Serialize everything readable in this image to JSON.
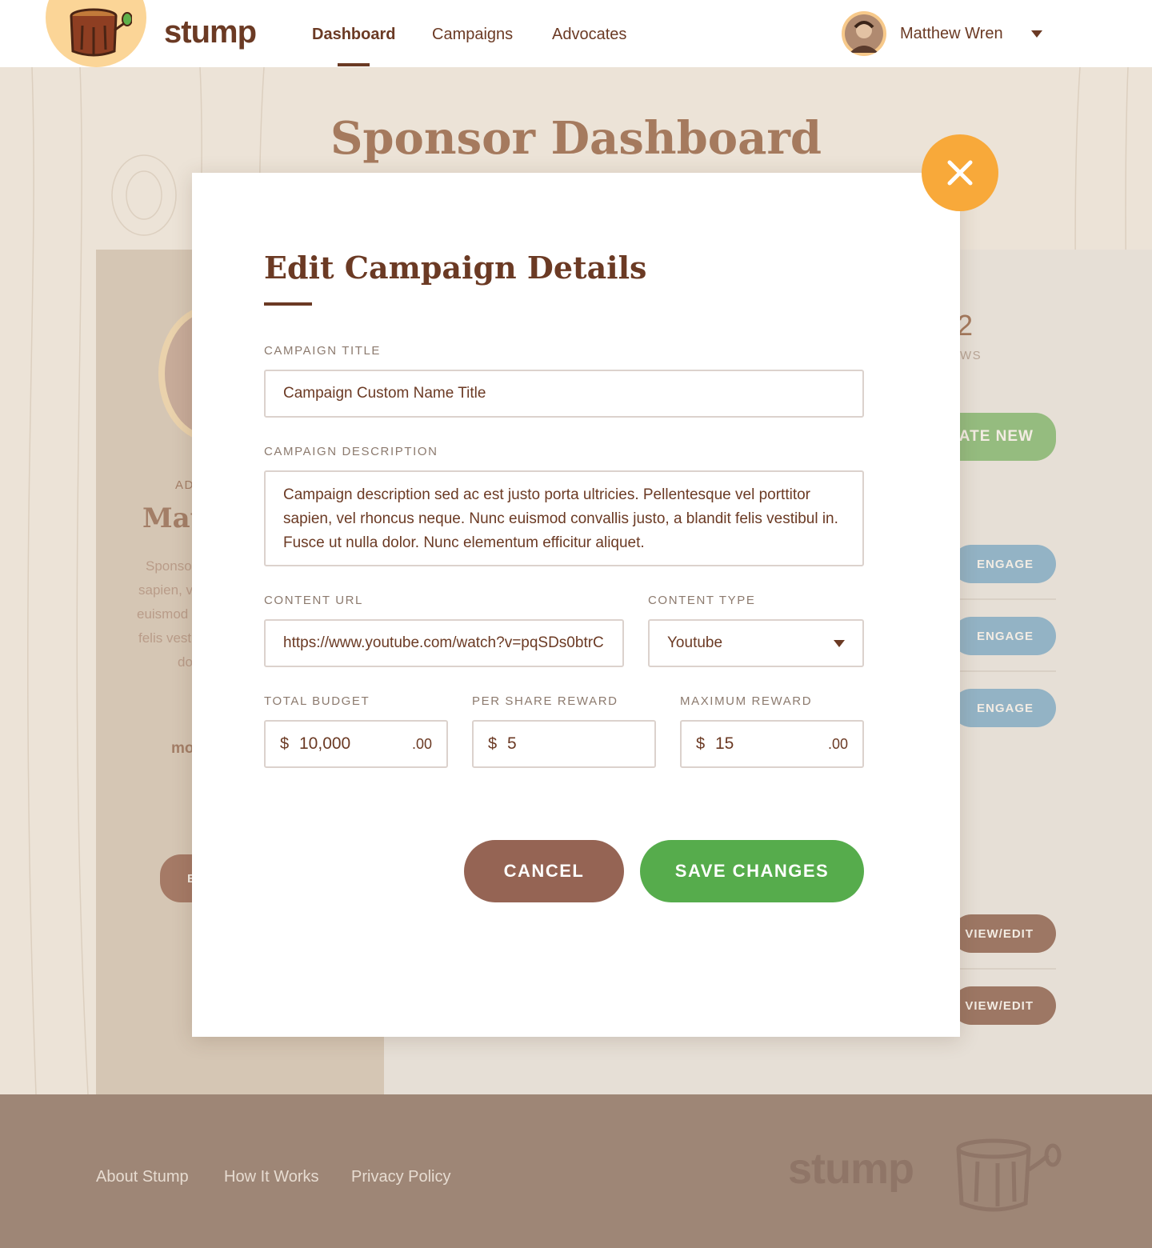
{
  "header": {
    "brand": "stump",
    "nav": [
      "Dashboard",
      "Campaigns",
      "Advocates"
    ],
    "active_nav": "Dashboard",
    "user_name": "Matthew Wren"
  },
  "background": {
    "page_title": "Sponsor Dashboard",
    "stat_value_fragment": "2",
    "stat_label_fragment": "WS",
    "create_button_fragment": "ATE NEW",
    "engage_label": "ENGAGE",
    "view_edit_label": "VIEW/EDIT",
    "left_card": {
      "role_fragment": "AD",
      "name_fragment": "Mat",
      "bio_fragments": [
        "Sponso",
        "sapien, v",
        "euismod",
        "felis vest",
        "do"
      ],
      "link_fragment": "mo",
      "button_fragment": "E"
    }
  },
  "modal": {
    "title": "Edit Campaign Details",
    "fields": {
      "title_label": "CAMPAIGN TITLE",
      "title_value": "Campaign Custom Name Title",
      "description_label": "CAMPAIGN DESCRIPTION",
      "description_value": "Campaign description sed ac est justo porta ultricies. Pellentesque vel porttitor sapien, vel rhoncus neque. Nunc euismod convallis justo, a blandit felis vestibul in. Fusce ut nulla dolor. Nunc elementum efficitur aliquet.",
      "url_label": "CONTENT URL",
      "url_value": "https://www.youtube.com/watch?v=pqSDs0btrC",
      "type_label": "CONTENT TYPE",
      "type_value": "Youtube",
      "budget_label": "TOTAL BUDGET",
      "budget_value": "10,000",
      "budget_cents": ".00",
      "per_share_label": "PER SHARE REWARD",
      "per_share_value": "5",
      "max_label": "MAXIMUM REWARD",
      "max_value": "15",
      "max_cents": ".00",
      "currency": "$"
    },
    "cancel_label": "CANCEL",
    "save_label": "SAVE CHANGES"
  },
  "footer": {
    "links": [
      "About Stump",
      "How It Works",
      "Privacy Policy"
    ],
    "brand": "stump"
  },
  "colors": {
    "brand_brown": "#6b3a24",
    "accent_orange": "#f8a93a",
    "save_green": "#56ac4c",
    "cancel_brown": "#956454",
    "engage_blue": "#93b3c5"
  }
}
